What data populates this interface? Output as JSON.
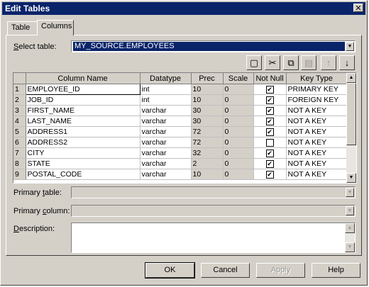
{
  "window": {
    "title": "Edit Tables",
    "close_glyph": "✕"
  },
  "tabs": [
    {
      "label": "Table"
    },
    {
      "label": "Columns"
    }
  ],
  "select_table": {
    "label_u": "S",
    "label_rest": "elect table:",
    "value": "MY_SOURCE.EMPLOYEES"
  },
  "toolbar": {
    "new_glyph": "▢",
    "cut_glyph": "✂",
    "copy_glyph": "⧉",
    "paste_glyph": "▤",
    "up_glyph": "↑",
    "down_glyph": "↓"
  },
  "grid": {
    "headers": [
      "",
      "Column Name",
      "Datatype",
      "Prec",
      "Scale",
      "Not Null",
      "Key Type"
    ],
    "rows": [
      {
        "n": "1",
        "name": "EMPLOYEE_ID",
        "type": "int",
        "prec": "10",
        "scale": "0",
        "notnull": true,
        "key": "PRIMARY KEY"
      },
      {
        "n": "2",
        "name": "JOB_ID",
        "type": "int",
        "prec": "10",
        "scale": "0",
        "notnull": true,
        "key": "FOREIGN KEY"
      },
      {
        "n": "3",
        "name": "FIRST_NAME",
        "type": "varchar",
        "prec": "30",
        "scale": "0",
        "notnull": true,
        "key": "NOT A KEY"
      },
      {
        "n": "4",
        "name": "LAST_NAME",
        "type": "varchar",
        "prec": "30",
        "scale": "0",
        "notnull": true,
        "key": "NOT A KEY"
      },
      {
        "n": "5",
        "name": "ADDRESS1",
        "type": "varchar",
        "prec": "72",
        "scale": "0",
        "notnull": true,
        "key": "NOT A KEY"
      },
      {
        "n": "6",
        "name": "ADDRESS2",
        "type": "varchar",
        "prec": "72",
        "scale": "0",
        "notnull": false,
        "key": "NOT A KEY"
      },
      {
        "n": "7",
        "name": "CITY",
        "type": "varchar",
        "prec": "32",
        "scale": "0",
        "notnull": true,
        "key": "NOT A KEY"
      },
      {
        "n": "8",
        "name": "STATE",
        "type": "varchar",
        "prec": "2",
        "scale": "0",
        "notnull": true,
        "key": "NOT A KEY"
      },
      {
        "n": "9",
        "name": "POSTAL_CODE",
        "type": "varchar",
        "prec": "10",
        "scale": "0",
        "notnull": true,
        "key": "NOT A KEY"
      }
    ],
    "check_glyph": "✔"
  },
  "primary_table": {
    "label_pre": "Primary ",
    "label_u": "t",
    "label_rest": "able:"
  },
  "primary_column": {
    "label_pre": "Primary ",
    "label_u": "c",
    "label_rest": "olumn:"
  },
  "description": {
    "label_u": "D",
    "label_rest": "escription:"
  },
  "buttons": {
    "ok": "OK",
    "cancel": "Cancel",
    "apply": "Apply",
    "help": "Help"
  }
}
